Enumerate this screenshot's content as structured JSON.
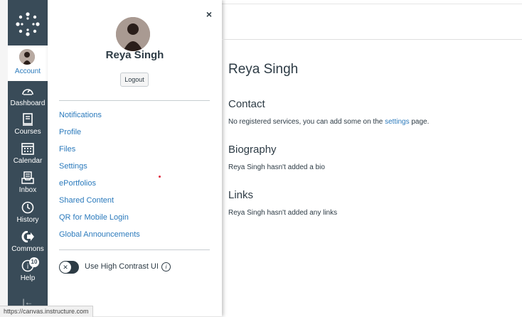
{
  "nav": {
    "account_label": "Account",
    "items": [
      {
        "label": "Dashboard",
        "icon": "dashboard-icon"
      },
      {
        "label": "Courses",
        "icon": "courses-icon"
      },
      {
        "label": "Calendar",
        "icon": "calendar-icon"
      },
      {
        "label": "Inbox",
        "icon": "inbox-icon"
      },
      {
        "label": "History",
        "icon": "history-icon"
      },
      {
        "label": "Commons",
        "icon": "commons-icon"
      },
      {
        "label": "Help",
        "icon": "help-icon"
      }
    ],
    "help_badge": "10"
  },
  "tray": {
    "close": "×",
    "user_name": "Reya Singh",
    "logout": "Logout",
    "links": [
      "Notifications",
      "Profile",
      "Files",
      "Settings",
      "ePortfolios",
      "Shared Content",
      "QR for Mobile Login",
      "Global Announcements"
    ],
    "toggle_knob": "✕",
    "toggle_label": "Use High Contrast UI",
    "info": "i"
  },
  "profile": {
    "title": "Reya Singh",
    "contact_heading": "Contact",
    "contact_text_before": "No registered services, you can add some on the ",
    "contact_link": "settings",
    "contact_text_after": " page.",
    "bio_heading": "Biography",
    "bio_text": "Reya Singh hasn't added a bio",
    "links_heading": "Links",
    "links_text": "Reya Singh hasn't added any links"
  },
  "status_url": "https://canvas.instructure.com",
  "colors": {
    "nav_bg": "#394b58",
    "link": "#2b7abc",
    "text": "#2d3b45"
  }
}
